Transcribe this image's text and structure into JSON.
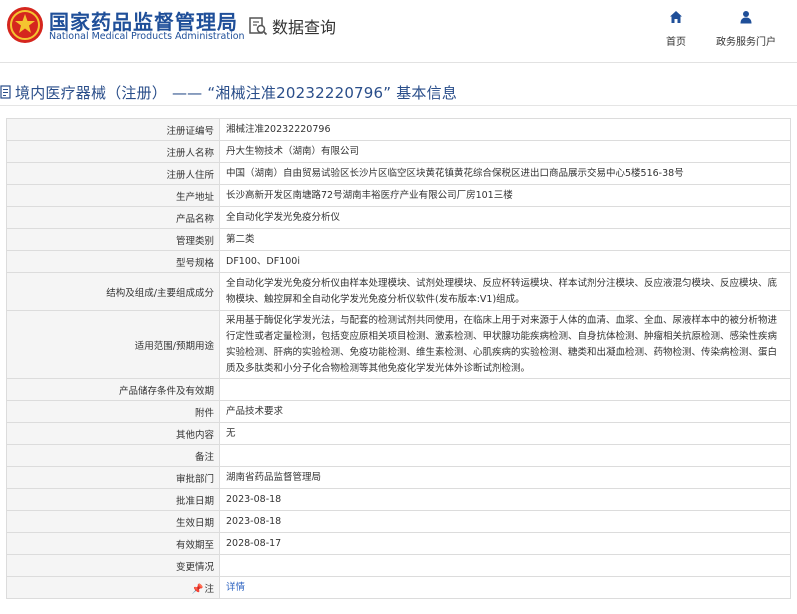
{
  "header": {
    "brand_cn": "国家药品监督管理局",
    "brand_en": "National Medical Products Administration",
    "query_label": "数据查询",
    "nav": [
      {
        "label": "首页",
        "icon": "home-icon"
      },
      {
        "label": "政务服务门户",
        "icon": "user-icon"
      }
    ]
  },
  "page_title": "境内医疗器械（注册） —— “湘械注准20232220796” 基本信息",
  "rows": [
    {
      "label": "注册证编号",
      "value": "湘械注准20232220796"
    },
    {
      "label": "注册人名称",
      "value": "丹大生物技术（湖南）有限公司"
    },
    {
      "label": "注册人住所",
      "value": "中国（湖南）自由贸易试验区长沙片区临空区块黄花镇黄花综合保税区进出口商品展示交易中心5楼516-38号"
    },
    {
      "label": "生产地址",
      "value": "长沙高新开发区南塘路72号湖南丰裕医疗产业有限公司厂房101三楼"
    },
    {
      "label": "产品名称",
      "value": "全自动化学发光免疫分析仪"
    },
    {
      "label": "管理类别",
      "value": "第二类"
    },
    {
      "label": "型号规格",
      "value": "DF100、DF100i"
    },
    {
      "label": "结构及组成/主要组成成分",
      "value": "全自动化学发光免疫分析仪由样本处理模块、试剂处理模块、反应杯转运模块、样本试剂分注模块、反应液混匀模块、反应模块、底物模块、触控屏和全自动化学发光免疫分析仪软件(发布版本:V1)组成。"
    },
    {
      "label": "适用范围/预期用途",
      "value": "采用基于酶促化学发光法，与配套的检测试剂共同使用，在临床上用于对来源于人体的血清、血浆、全血、尿液样本中的被分析物进行定性或者定量检测，包括变应原相关项目检测、激素检测、甲状腺功能疾病检测、自身抗体检测、肿瘤相关抗原检测、感染性疾病实验检测、肝病的实验检测、免疫功能检测、维生素检测、心肌疾病的实验检测、糖类和出凝血检测、药物检测、传染病检测、蛋白质及多肽类和小分子化合物检测等其他免疫化学发光体外诊断试剂检测。"
    },
    {
      "label": "产品储存条件及有效期",
      "value": ""
    },
    {
      "label": "附件",
      "value": "产品技术要求"
    },
    {
      "label": "其他内容",
      "value": "无"
    },
    {
      "label": "备注",
      "value": ""
    },
    {
      "label": "审批部门",
      "value": "湖南省药品监督管理局"
    },
    {
      "label": "批准日期",
      "value": "2023-08-18"
    },
    {
      "label": "生效日期",
      "value": "2023-08-18"
    },
    {
      "label": "有效期至",
      "value": "2028-08-17"
    },
    {
      "label": "变更情况",
      "value": ""
    },
    {
      "label": "注",
      "value": "详情"
    }
  ],
  "colors": {
    "brand": "#1f4f99",
    "link": "#2b62c0",
    "title": "#2a4e8a"
  }
}
